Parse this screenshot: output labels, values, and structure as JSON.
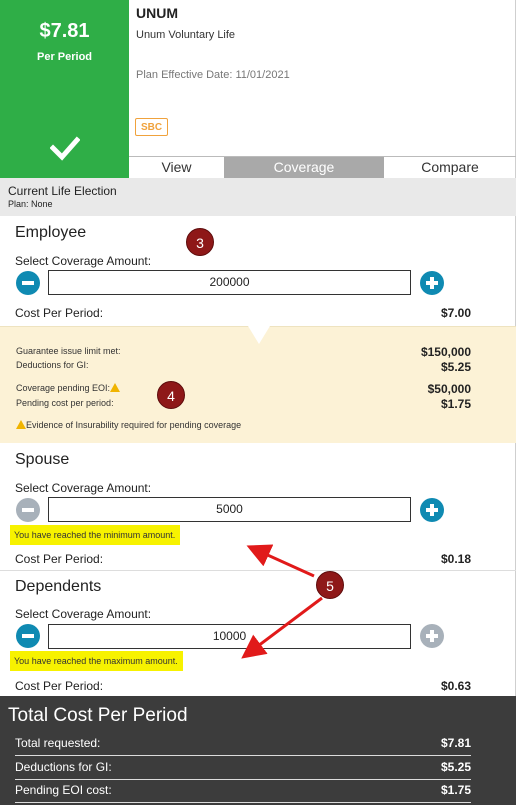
{
  "header": {
    "price": "$7.81",
    "price_label": "Per Period",
    "carrier": "UNUM",
    "plan_name": "Unum Voluntary Life",
    "effective_date": "Plan Effective Date: 11/01/2021",
    "sbc_label": "SBC"
  },
  "tabs": [
    {
      "label": "View",
      "active": false
    },
    {
      "label": "Coverage",
      "active": true
    },
    {
      "label": "Compare",
      "active": false
    }
  ],
  "current_election": {
    "title": "Current Life Election",
    "plan": "Plan: None"
  },
  "employee": {
    "title": "Employee",
    "select_label": "Select Coverage Amount:",
    "amount": "200000",
    "cost_label": "Cost Per Period:",
    "cost_value": "$7.00"
  },
  "eoi": {
    "gi_label": "Guarantee issue limit met:",
    "gi_value": "$150,000",
    "deductions_label": "Deductions for GI:",
    "deductions_value": "$5.25",
    "pending_label": "Coverage pending EOI:",
    "pending_value": "$50,000",
    "pending_cost_label": "Pending cost per period:",
    "pending_cost_value": "$1.75",
    "note": "Evidence of Insurability required for pending coverage"
  },
  "spouse": {
    "title": "Spouse",
    "select_label": "Select Coverage Amount:",
    "amount": "5000",
    "warning": "You have reached the minimum amount.",
    "cost_label": "Cost Per Period:",
    "cost_value": "$0.18"
  },
  "dependents": {
    "title": "Dependents",
    "select_label": "Select Coverage Amount:",
    "amount": "10000",
    "warning": "You have reached the maximum amount.",
    "cost_label": "Cost Per Period:",
    "cost_value": "$0.63"
  },
  "total": {
    "title": "Total Cost Per Period",
    "requested_label": "Total requested:",
    "requested_value": "$7.81",
    "deductions_label": "Deductions for GI:",
    "deductions_value": "$5.25",
    "pending_label": "Pending EOI cost:",
    "pending_value": "$1.75"
  },
  "annotations": [
    "3",
    "4",
    "5"
  ],
  "colors": {
    "price_bg": "#2fae47",
    "accent_button": "#0f8ab2",
    "disabled_button": "#a8b1ba",
    "eoi_bg": "#fcf2d6",
    "highlight": "#f7f200",
    "annotation": "#8e1818",
    "total_bg": "#3c3c3c",
    "sbc": "#f0a23c"
  }
}
